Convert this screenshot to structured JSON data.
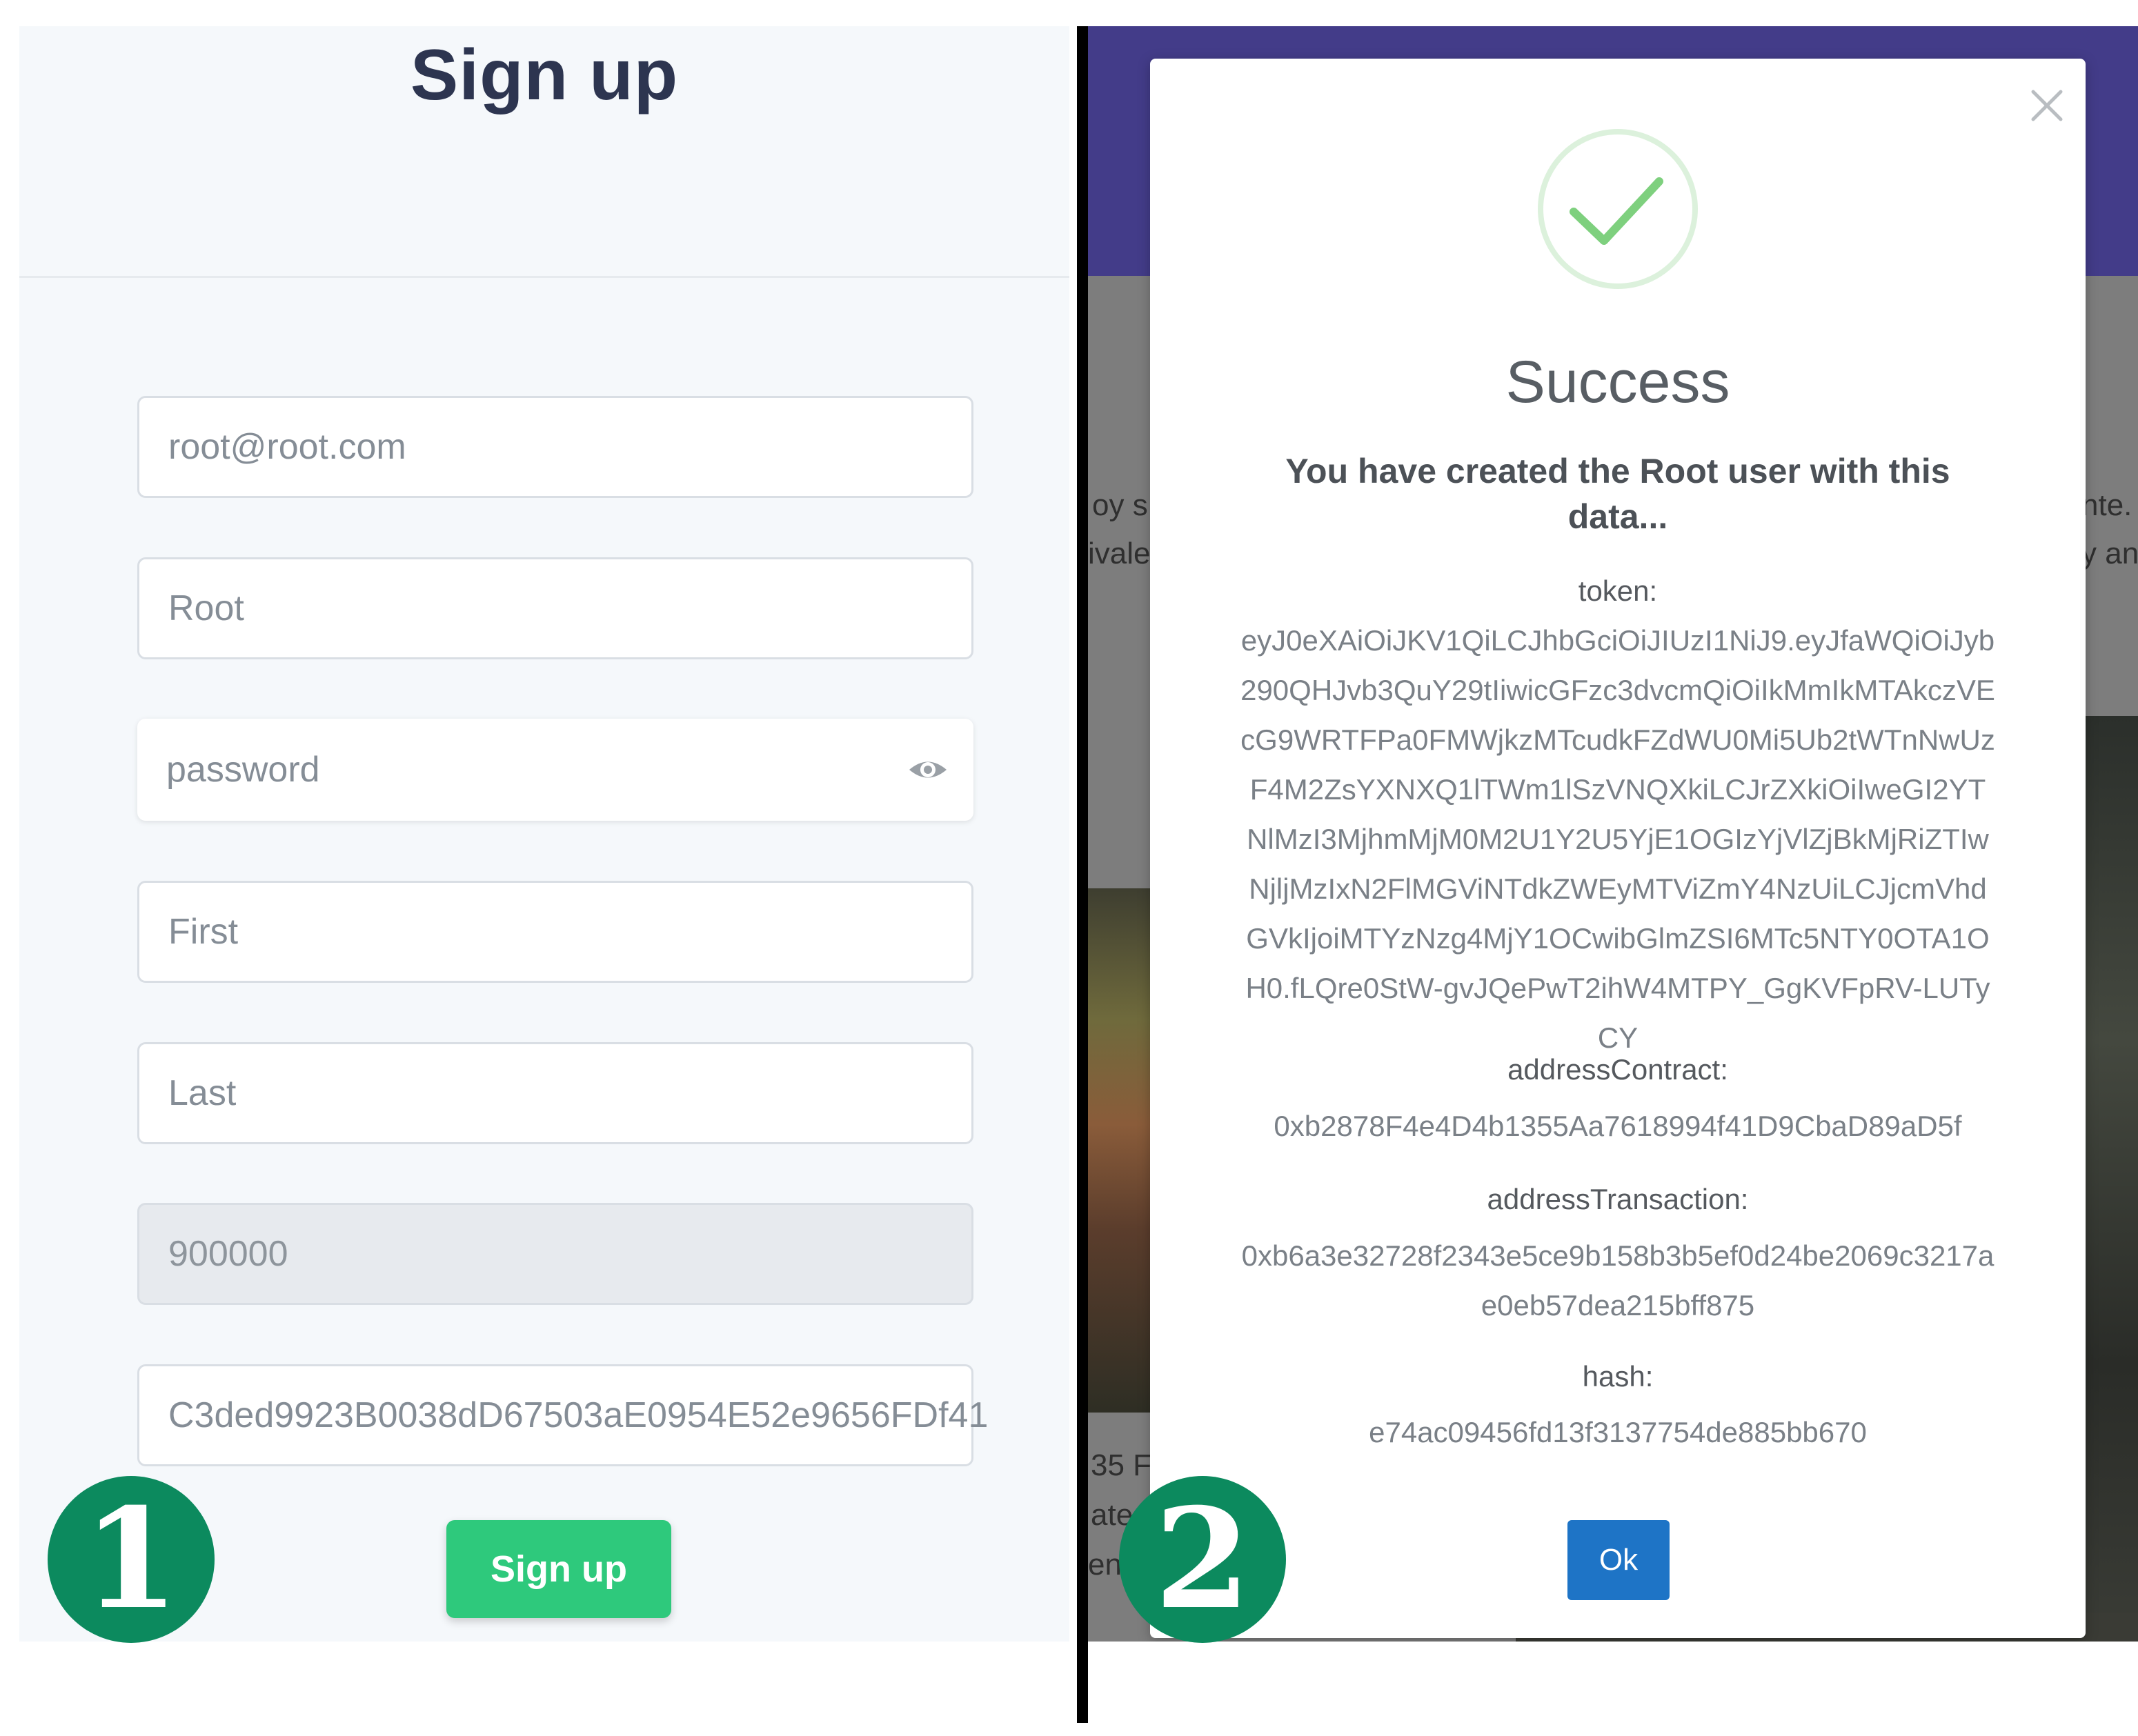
{
  "signup": {
    "title": "Sign up",
    "email_value": "root@root.com",
    "username_value": "Root",
    "password_placeholder": "password",
    "first_name_value": "First",
    "last_name_value": "Last",
    "amount_value": "900000",
    "wallet_value": "C3ded9923B0038dD67503aE0954E52e9656FDf41",
    "submit_label": "Sign up",
    "icons": {
      "password_toggle": "eye-icon"
    }
  },
  "badges": {
    "step1": "1",
    "step2": "2"
  },
  "background_fragments": [
    "oy s",
    "ivale",
    "nte.",
    "y an",
    "35 F",
    "ate",
    "en"
  ],
  "modal": {
    "title": "Success",
    "message": "You have created the Root user with this data...",
    "token_label": "token:",
    "token_value": "eyJ0eXAiOiJKV1QiLCJhbGciOiJIUzI1NiJ9.eyJfaWQiOiJyb290QHJvb3QuY29tIiwicGFzc3dvcmQiOiIkMmIkMTAkczVEcG9WRTFPa0FMWjkzMTcudkFZdWU0Mi5Ub2tWTnNwUzF4M2ZsYXNXQ1lTWm1lSzVNQXkiLCJrZXkiOiIweGI2YTNlMzI3MjhmMjM0M2U1Y2U5YjE1OGIzYjVlZjBkMjRiZTIwNjljMzIxN2FlMGViNTdkZWEyMTViZmY4NzUiLCJjcmVhdGVkIjoiMTYzNzg4MjY1OCwibGlmZSI6MTc5NTY0OTA1OH0.fLQre0StW-gvJQePwT2ihW4MTPY_GgKVFpRV-LUTyCY",
    "address_contract_label": "addressContract:",
    "address_contract_value": "0xb2878F4e4D4b1355Aa7618994f41D9CbaD89aD5f",
    "address_transaction_label": "addressTransaction:",
    "address_transaction_value": "0xb6a3e32728f2343e5ce9b158b3b5ef0d24be2069c3217ae0eb57dea215bff875",
    "hash_label": "hash:",
    "hash_value": "e74ac09456fd13f3137754de885bb670",
    "ok_label": "Ok",
    "icons": {
      "close": "close-icon",
      "status": "check-circle-icon"
    }
  },
  "colors": {
    "signup_button": "#2ec97c",
    "badge": "#0c8a5e",
    "ok_button": "#1e74c6",
    "header_band": "#433c89",
    "success_check": "#7ed07e"
  }
}
